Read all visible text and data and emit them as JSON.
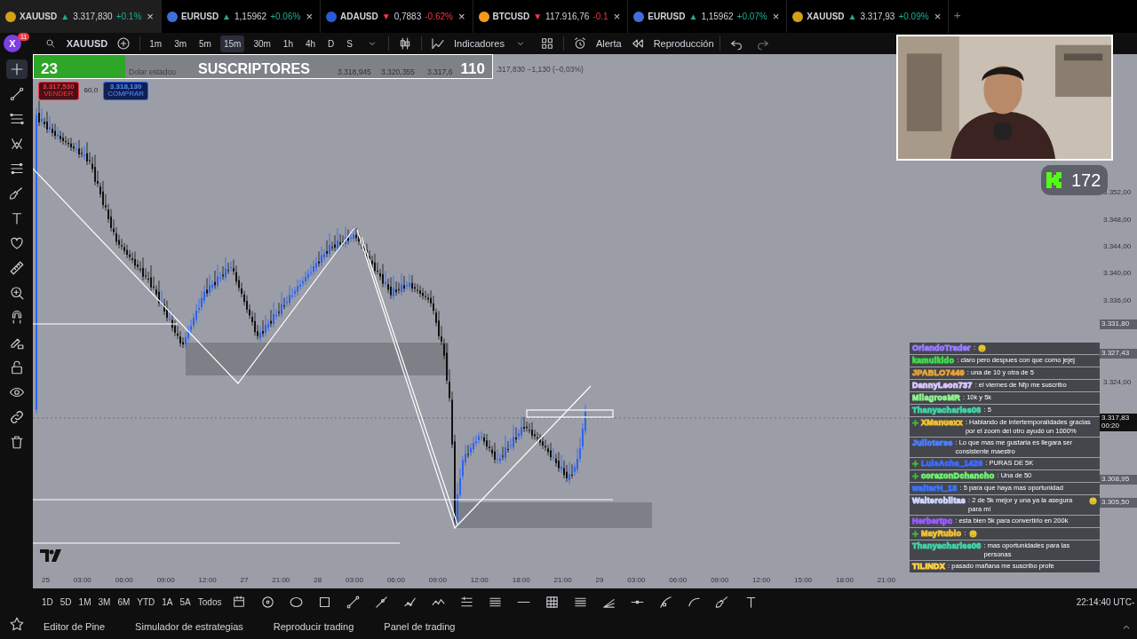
{
  "tabs": [
    {
      "symbol": "XAUUSD",
      "arrow": "▲",
      "rising": true,
      "price": "3.317,830",
      "change": "+0.1%",
      "close": "×",
      "color": "#d4a017",
      "selected": true
    },
    {
      "symbol": "EURUSD",
      "arrow": "▲",
      "rising": true,
      "price": "1,15962",
      "change": "+0.06%",
      "close": "×",
      "color": "#3d6fd8",
      "selected": false
    },
    {
      "symbol": "ADAUSD",
      "arrow": "▼",
      "rising": false,
      "price": "0,7883",
      "change": "-0.62%",
      "close": "×",
      "color": "#2a5ad8",
      "selected": false
    },
    {
      "symbol": "BTCUSD",
      "arrow": "▼",
      "rising": false,
      "price": "117.916,76",
      "change": "-0.1",
      "close": "×",
      "color": "#f39a1e",
      "selected": false
    },
    {
      "symbol": "EURUSD",
      "arrow": "▲",
      "rising": true,
      "price": "1,15962",
      "change": "+0.07%",
      "close": "×",
      "color": "#3d6fd8",
      "selected": false
    },
    {
      "symbol": "XAUUSD",
      "arrow": "▲",
      "rising": true,
      "price": "3.317,93",
      "change": "+0.09%",
      "close": "×",
      "color": "#d4a017",
      "selected": false
    }
  ],
  "add_tab": "+",
  "toolbar": {
    "avatar": "X",
    "notifications": "11",
    "symbol": "XAUUSD",
    "intervals": [
      {
        "label": "1m",
        "selected": false
      },
      {
        "label": "3m",
        "selected": false
      },
      {
        "label": "5m",
        "selected": false
      },
      {
        "label": "15m",
        "selected": true
      },
      {
        "label": "30m",
        "selected": false
      },
      {
        "label": "1h",
        "selected": false
      },
      {
        "label": "4h",
        "selected": false
      },
      {
        "label": "D",
        "selected": false
      },
      {
        "label": "S",
        "selected": false
      }
    ],
    "indicators": "Indicadores",
    "alert": "Alerta",
    "replay": "Reproducción"
  },
  "legend": {
    "name": "Dolar estadou",
    "values": [
      "3.318,945",
      "3.320,355",
      "3.317,6"
    ],
    "last": ".317,830 −1,130 (−0,03%)"
  },
  "trade": {
    "sell_price": "3.317,530",
    "sell": "VENDER",
    "spread": "60,0",
    "buy_price": "3.318,130",
    "buy": "COMPRAR"
  },
  "subscribers": {
    "current": "23",
    "label": "SUSCRIPTORES",
    "goal": "110",
    "level": 0.2
  },
  "viewers": "172",
  "price_axis": {
    "ticks": [
      "3.352,00",
      "3.348,00",
      "3.344,00",
      "3.340,00",
      "3.336,00",
      "3.324,00"
    ],
    "tags": [
      {
        "price": "3.331,80"
      },
      {
        "price": "3.327,43"
      },
      {
        "price": "3.317,83",
        "time": "00:20"
      },
      {
        "price": "3.308,95"
      },
      {
        "price": "3.305,50"
      }
    ]
  },
  "time_axis": [
    "25",
    "03:00",
    "06:00",
    "09:00",
    "12:00",
    "27",
    "21:00",
    "28",
    "03:00",
    "06:00",
    "09:00",
    "12:00",
    "18:00",
    "21:00",
    "29",
    "03:00",
    "06:00",
    "09:00",
    "12:00",
    "15:00",
    "18:00",
    "21:00"
  ],
  "chat": [
    {
      "user": "OrlandoTrader",
      "color": "#9b7bff",
      "text": ":",
      "badge": false,
      "emote": true
    },
    {
      "user": "kamuikido",
      "color": "#3ddc4a",
      "text": ": claro pero despues con que como jejej",
      "badge": false,
      "emote": false
    },
    {
      "user": "JPABLO7449",
      "color": "#e8a23a",
      "text": ": una de 10 y otra de 5",
      "badge": false,
      "emote": false
    },
    {
      "user": "DannyLeon737",
      "color": "#d9c7ff",
      "text": ": el viernes de Nfp me suscribo",
      "badge": false,
      "emote": false
    },
    {
      "user": "MilagrosMR",
      "color": "#8cf08c",
      "text": ": 10k y 5k",
      "badge": false,
      "emote": false
    },
    {
      "user": "Thanyacharles06",
      "color": "#3fd1a8",
      "text": ": 5",
      "badge": false,
      "emote": false
    },
    {
      "user": "XManuexx",
      "color": "#f0c030",
      "text": ": Hablando de intertemporalidades gracias por el zoom del otro ayudó un 1000%",
      "badge": true,
      "emote": false
    },
    {
      "user": "Julioterse",
      "color": "#4d7dff",
      "text": ": Lo que mas me gustaria es llegara ser consistente maestro",
      "badge": false,
      "emote": false
    },
    {
      "user": "LuisAche_1426",
      "color": "#3d6bff",
      "text": ": PURAS DE 5K",
      "badge": true,
      "emote": false
    },
    {
      "user": "corazonDchancho",
      "color": "#6ef06e",
      "text": ": Una de 50",
      "badge": true,
      "emote": false
    },
    {
      "user": "walterH_18",
      "color": "#3a74ff",
      "text": ": 5 para que haya mas oportunidad",
      "badge": false,
      "emote": false
    },
    {
      "user": "Walterobiitas",
      "color": "#cfd6ff",
      "text": ": 2 de 5k mejor y una ya la asegura para mi",
      "badge": false,
      "emote": true
    },
    {
      "user": "Herbertpc",
      "color": "#9a5cff",
      "text": ": esta bien 5k para convertirlo en 200k",
      "badge": false,
      "emote": false
    },
    {
      "user": "MayRubio",
      "color": "#f0c030",
      "text": ":",
      "badge": true,
      "emote": true
    },
    {
      "user": "Thanyacharles06",
      "color": "#3fd1a8",
      "text": ": mas oportunidades para las personas",
      "badge": false,
      "emote": false
    },
    {
      "user": "TILINDX",
      "color": "#ffcf40",
      "text": ": pasado mañana me suscribo profe",
      "badge": false,
      "emote": false
    }
  ],
  "ranges": [
    "1D",
    "5D",
    "1M",
    "3M",
    "6M",
    "YTD",
    "1A",
    "5A",
    "Todos"
  ],
  "clock": "22:14:40 UTC-",
  "footer_tabs": [
    "Editor de Pine",
    "Simulador de estrategias",
    "Reproducir trading",
    "Panel de trading"
  ]
}
